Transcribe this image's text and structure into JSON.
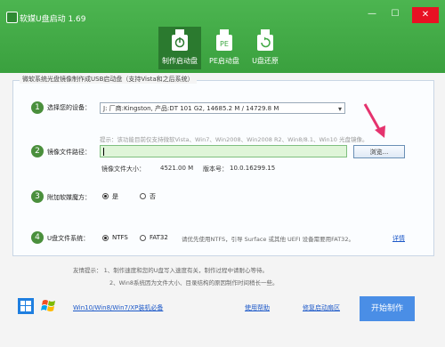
{
  "window": {
    "title": "软媒U盘启动 1.69"
  },
  "tabs": [
    {
      "label": "制作启动盘"
    },
    {
      "label": "PE启动盘"
    },
    {
      "label": "U盘还原"
    }
  ],
  "panel": {
    "title": "微软系统光盘镜像制作成USB启动盘（支持Vista和之后系统）"
  },
  "steps": {
    "device": {
      "num": "1",
      "label": "选择您的设备：",
      "value": "J: 厂商:Kingston, 产品:DT 101 G2,  14685.2 M / 14729.8 M"
    },
    "image": {
      "num": "2",
      "label": "镜像文件路径：",
      "hint": "提示：该功能目前仅支持微软Vista、Win7、Win2008、Win2008 R2、Win8/8.1、Win10 光盘镜像。",
      "browse": "浏览...",
      "size_label": "镜像文件大小：",
      "size_value": "4521.00 M",
      "version_label": "版本号：",
      "version_value": "10.0.16299.15"
    },
    "magic": {
      "num": "3",
      "label": "附加软媒魔方：",
      "yes": "是",
      "no": "否"
    },
    "fs": {
      "num": "4",
      "label": "U盘文件系统：",
      "ntfs": "NTFS",
      "fat32": "FAT32",
      "note": "请优先使用NTFS，引导 Surface 或其他 UEFI 设备需要用FAT32。",
      "detail": "详情"
    }
  },
  "tips": {
    "line1": "友情提示： 1、制作速度和您的U盘写入速度有关，制作过程中请耐心等待。",
    "line2": "2、Win8系统因为文件大小、目录结构的原因制作时间稍长一些。"
  },
  "footer": {
    "os_link": "Win10/Win8/Win7/XP装机必备",
    "help": "使用帮助",
    "repair": "修复启动扇区",
    "start": "开始制作"
  },
  "colors": {
    "header": "#3fa843",
    "accent": "#4a8f3c",
    "arrow": "#e5336e",
    "start": "#4a8ee6"
  }
}
